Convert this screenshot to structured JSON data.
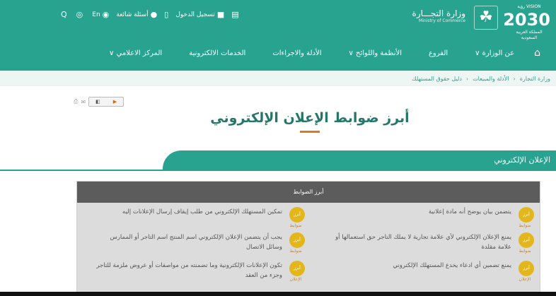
{
  "header": {
    "vision": {
      "top": "VISION رؤية",
      "number": "2030",
      "bottom": "المملكة العربية السعودية"
    },
    "ministry": {
      "arabic": "وزارة التجـــارة",
      "english": "Ministry of Commerce"
    },
    "tools": [
      {
        "icon": "search-icon",
        "glyph": "Q",
        "label": ""
      },
      {
        "icon": "accessibility-icon",
        "glyph": "◎",
        "label": ""
      },
      {
        "icon": "language-icon",
        "glyph": "◉",
        "label": "En"
      },
      {
        "icon": "info-icon",
        "glyph": "●",
        "label": "أسئلة شائعة"
      },
      {
        "icon": "phone-icon",
        "glyph": "▯",
        "label": ""
      },
      {
        "icon": "lock-icon",
        "glyph": "■",
        "label": "تسجيل الدخول"
      },
      {
        "icon": "map-icon",
        "glyph": "▤",
        "label": ""
      }
    ]
  },
  "nav": {
    "items": [
      "عن الوزارة ∨",
      "الفروع",
      "الأنظمة واللوائح ∨",
      "الأدلة والاجراءات",
      "الخدمات الالكترونية",
      "المركز الاعلامي ∨"
    ]
  },
  "breadcrumb": [
    "وزارة التجارة",
    "الأدلة والمبيعات",
    "دليل حقوق المستهلك"
  ],
  "page": {
    "title": "أبرز ضوابط الإعلان الإلكتروني",
    "band_label": "الإعلان الإلكتروني",
    "panel_header": "أبرز الضوابط",
    "badge_text": "أبرز",
    "badge_tag": "ضوابط",
    "controls": [
      {
        "text": "يتضمن بيان يوضح أنه مادة إعلانية",
        "tag": "ضوابط"
      },
      {
        "text": "تمكين المستهلك الإلكتروني من طلب إيقاف إرسال الإعلانات إليه",
        "tag": "ضوابط"
      },
      {
        "text": "يمنع الإعلان الإلكتروني لأي علامة تجارية لا يملك التاجر حق استعمالها أو علامة مقلدة",
        "tag": "ضوابط"
      },
      {
        "text": "يجب أن يتضمن الإعلان الإلكتروني اسم المنتج اسم التاجر أو الممارس وسائل الاتصال",
        "tag": "ضوابط"
      },
      {
        "text": "يمنع تضمين أي ادعاء يخدع المستهلك الإلكتروني",
        "tag": "الإعلان"
      },
      {
        "text": "تكون الإعلانات الإلكترونية وما تضمنته من مواصفات أو عروض ملزمة للتاجر وجزء من العقد",
        "tag": "الإعلان"
      }
    ]
  },
  "colors": {
    "brand": "#27a38f",
    "accent": "#e07a20",
    "badge": "#e3b61b"
  }
}
